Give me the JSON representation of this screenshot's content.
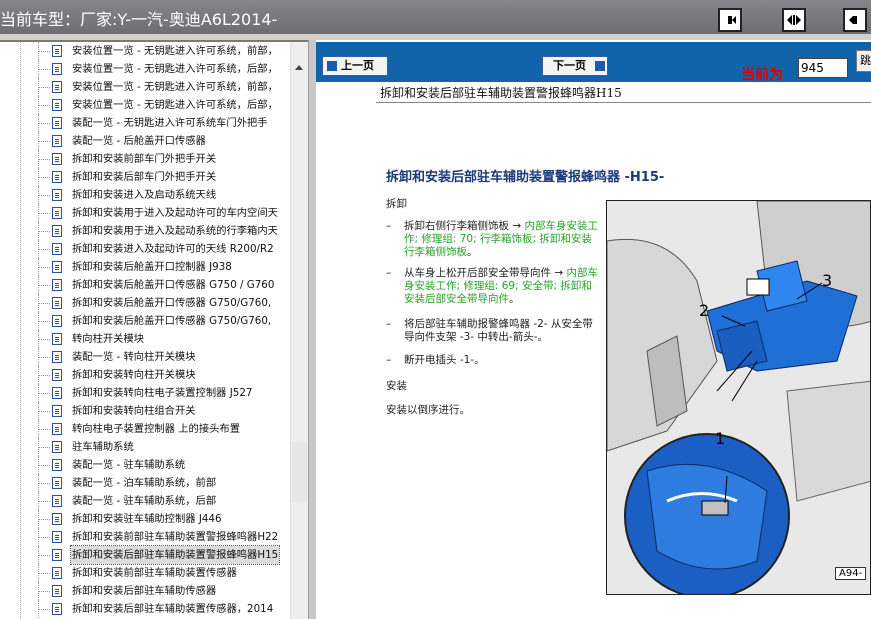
{
  "window": {
    "title": "当前车型：厂家:Y-一汽-奥迪A6L2014-"
  },
  "toolbar": {
    "buttons": [
      {
        "name": "collapse-left",
        "icon": "panel-left-icon"
      },
      {
        "name": "split-view",
        "icon": "split-icon"
      },
      {
        "name": "collapse-right",
        "icon": "panel-right-icon"
      }
    ]
  },
  "tree": {
    "items": [
      {
        "label": "安装位置一览 - 无钥匙进入许可系统，前部，",
        "selected": false
      },
      {
        "label": "安装位置一览 - 无钥匙进入许可系统，后部，",
        "selected": false
      },
      {
        "label": "安装位置一览 - 无钥匙进入许可系统，前部，",
        "selected": false
      },
      {
        "label": "安装位置一览 - 无钥匙进入许可系统，后部，",
        "selected": false
      },
      {
        "label": "装配一览 - 无钥匙进入许可系统车门外把手",
        "selected": false
      },
      {
        "label": "装配一览 - 后舱盖开口传感器",
        "selected": false
      },
      {
        "label": "拆卸和安装前部车门外把手开关",
        "selected": false
      },
      {
        "label": "拆卸和安装后部车门外把手开关",
        "selected": false
      },
      {
        "label": "拆卸和安装进入及启动系统天线",
        "selected": false
      },
      {
        "label": "拆卸和安装用于进入及起动许可的车内空间天",
        "selected": false
      },
      {
        "label": "拆卸和安装用于进入及起动系统的行李箱内天",
        "selected": false
      },
      {
        "label": "拆卸和安装进入及起动许可的天线 R200/R2",
        "selected": false
      },
      {
        "label": "拆卸和安装后舱盖开口控制器 J938",
        "selected": false
      },
      {
        "label": "拆卸和安装后舱盖开口传感器 G750 / G760",
        "selected": false
      },
      {
        "label": "拆卸和安装后舱盖开口传感器 G750/G760,",
        "selected": false
      },
      {
        "label": "拆卸和安装后舱盖开口传感器 G750/G760,",
        "selected": false
      },
      {
        "label": "转向柱开关模块",
        "selected": false
      },
      {
        "label": "装配一览 - 转向柱开关模块",
        "selected": false
      },
      {
        "label": "拆卸和安装转向柱开关模块",
        "selected": false
      },
      {
        "label": "拆卸和安装转向柱电子装置控制器 J527",
        "selected": false
      },
      {
        "label": "拆卸和安装转向柱组合开关",
        "selected": false
      },
      {
        "label": "转向柱电子装置控制器 上的接头布置",
        "selected": false
      },
      {
        "label": "驻车辅助系统",
        "selected": false
      },
      {
        "label": "装配一览 - 驻车辅助系统",
        "selected": false
      },
      {
        "label": "装配一览 - 泊车辅助系统，前部",
        "selected": false
      },
      {
        "label": "装配一览 - 驻车辅助系统，后部",
        "selected": false
      },
      {
        "label": "拆卸和安装驻车辅助控制器 J446",
        "selected": false
      },
      {
        "label": "拆卸和安装前部驻车辅助装置警报蜂鸣器H22",
        "selected": false
      },
      {
        "label": "拆卸和安装后部驻车辅助装置警报蜂鸣器H15",
        "selected": true
      },
      {
        "label": "拆卸和安装前部驻车辅助装置传感器",
        "selected": false
      },
      {
        "label": "拆卸和安装后部驻车辅助传感器",
        "selected": false
      },
      {
        "label": "拆卸和安装后部驻车辅助装置传感器，2014",
        "selected": false
      }
    ]
  },
  "nav": {
    "prev_label": "上一页",
    "next_label": "下一页",
    "page_label": "当前为",
    "page_value": "945",
    "go_label": "跳"
  },
  "doc": {
    "header": "拆卸和安装后部驻车辅助装置警报蜂鸣器H15",
    "title": "拆卸和安装后部驻车辅助装置警报蜂鸣器 -H15-",
    "remove_heading": "拆卸",
    "steps": [
      {
        "prefix": "拆卸右侧行李箱侧饰板 → ",
        "link": "内部车身安装工作; 修理组: 70; 行李箱饰板; 拆卸和安装行李箱侧饰板",
        "suffix": "。"
      },
      {
        "prefix": "从车身上松开后部安全带导向件 → ",
        "link": "内部车身安装工作; 修理组: 69; 安全带; 拆卸和安装后部安全带导向件",
        "suffix": "。"
      },
      {
        "prefix": "将后部驻车辅助报警蜂鸣器 -2- 从安全带导向件支架 -3- 中转出-箭头-。",
        "link": "",
        "suffix": ""
      },
      {
        "prefix": "断开电插头 -1-。",
        "link": "",
        "suffix": ""
      }
    ],
    "install_heading": "安装",
    "install_text": "安装以倒序进行。",
    "figure": {
      "callouts": [
        "1",
        "2",
        "3"
      ],
      "code": "A94-"
    }
  }
}
